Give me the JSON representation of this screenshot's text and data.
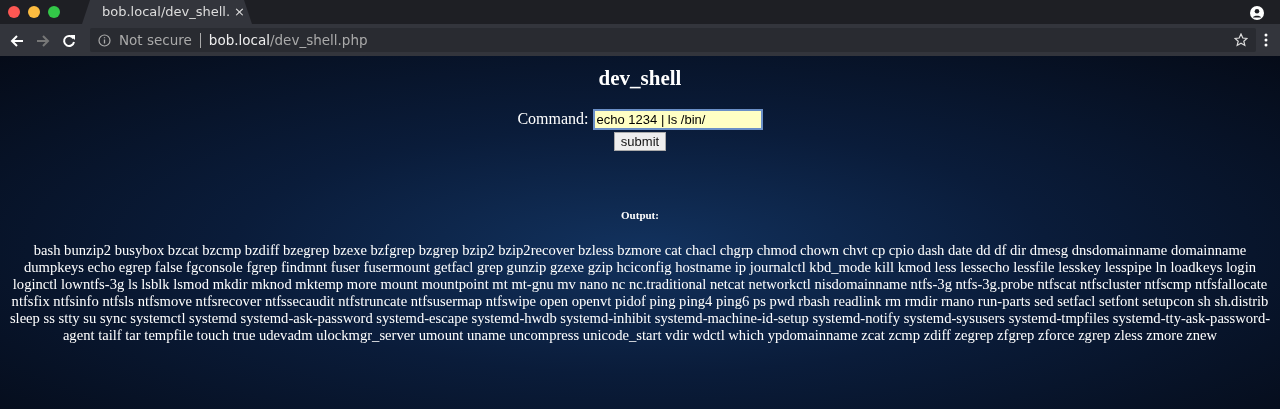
{
  "browser": {
    "tab": {
      "title": "bob.local/dev_shell.",
      "close": "×"
    },
    "address": {
      "security": "Not secure",
      "host": "bob.local",
      "path": "/dev_shell.php"
    }
  },
  "page": {
    "title": "dev_shell",
    "command_label": "Command:",
    "command_value": "echo 1234 | ls /bin/",
    "submit": "submit",
    "output_heading": "Output:",
    "output": "bash bunzip2 busybox bzcat bzcmp bzdiff bzegrep bzexe bzfgrep bzgrep bzip2 bzip2recover bzless bzmore cat chacl chgrp chmod chown chvt cp cpio dash date dd df dir dmesg dnsdomainname domainname dumpkeys echo egrep false fgconsole fgrep findmnt fuser fusermount getfacl grep gunzip gzexe gzip hciconfig hostname ip journalctl kbd_mode kill kmod less lessecho lessfile lesskey lesspipe ln loadkeys login loginctl lowntfs-3g ls lsblk lsmod mkdir mknod mktemp more mount mountpoint mt mt-gnu mv nano nc nc.traditional netcat networkctl nisdomainname ntfs-3g ntfs-3g.probe ntfscat ntfscluster ntfscmp ntfsfallocate ntfsfix ntfsinfo ntfsls ntfsmove ntfsrecover ntfssecaudit ntfstruncate ntfsusermap ntfswipe open openvt pidof ping ping4 ping6 ps pwd rbash readlink rm rmdir rnano run-parts sed setfacl setfont setupcon sh sh.distrib sleep ss stty su sync systemctl systemd systemd-ask-password systemd-escape systemd-hwdb systemd-inhibit systemd-machine-id-setup systemd-notify systemd-sysusers systemd-tmpfiles systemd-tty-ask-password-agent tailf tar tempfile touch true udevadm ulockmgr_server umount uname uncompress unicode_start vdir wdctl which ypdomainname zcat zcmp zdiff zegrep zfgrep zforce zgrep zless zmore znew"
  }
}
